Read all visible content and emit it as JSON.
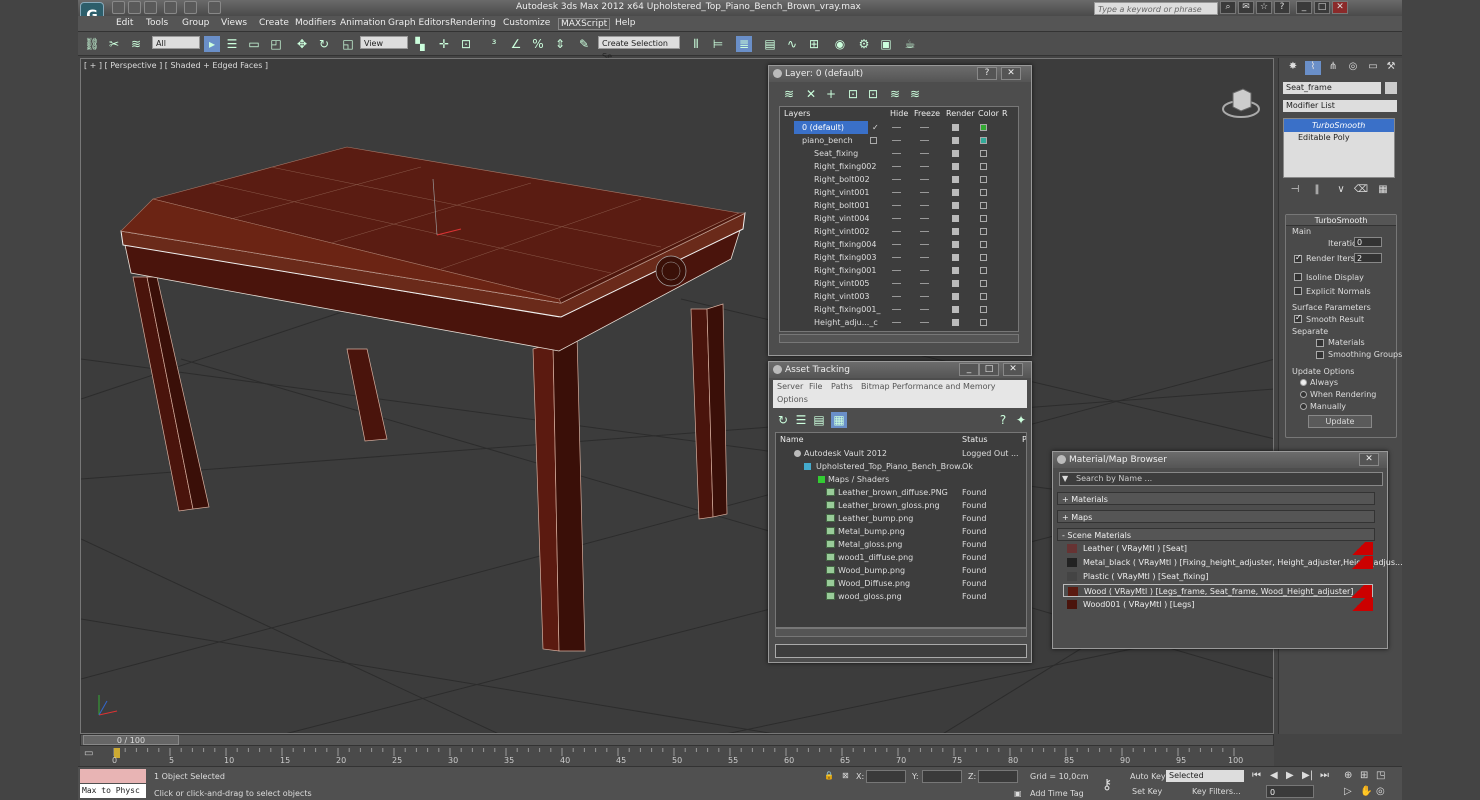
{
  "titlebar": {
    "text": "Autodesk 3ds Max  2012 x64     Upholstered_Top_Piano_Bench_Brown_vray.max",
    "search_placeholder": "Type a keyword or phrase"
  },
  "menu": [
    "Edit",
    "Tools",
    "Group",
    "Views",
    "Create",
    "Modifiers",
    "Animation",
    "Graph Editors",
    "Rendering",
    "Customize",
    "MAXScript",
    "Help"
  ],
  "toolbar": {
    "filter": "All",
    "refcoord": "View",
    "selset": "Create Selection Se"
  },
  "viewport": {
    "label": "[ + ] [ Perspective ] [ Shaded + Edged Faces ]"
  },
  "cmd": {
    "object_name": "Seat_frame",
    "modifier_list": "Modifier List",
    "stack": [
      "TurboSmooth",
      "Editable Poly"
    ],
    "turbosmooth": {
      "title": "TurboSmooth",
      "main": "Main",
      "iterations_label": "Iterations:",
      "iterations": "0",
      "render_iters_label": "Render Iters:",
      "render_iters": "2",
      "isoline": "Isoline Display",
      "explicit": "Explicit Normals",
      "surface": "Surface Parameters",
      "smooth_result": "Smooth Result",
      "separate": "Separate",
      "materials": "Materials",
      "smoothing_groups": "Smoothing Groups",
      "update_options": "Update Options",
      "always": "Always",
      "when_rendering": "When Rendering",
      "manually": "Manually",
      "update": "Update"
    }
  },
  "layer": {
    "title": "Layer: 0 (default)",
    "cols": [
      "Layers",
      "Hide",
      "Freeze",
      "Render",
      "Color",
      "R"
    ],
    "rows": [
      "0 (default)",
      "piano_bench",
      "Seat_fixing",
      "Right_fixing002",
      "Right_bolt002",
      "Right_vint001",
      "Right_bolt001",
      "Right_vint004",
      "Right_vint002",
      "Right_fixing004",
      "Right_fixing003",
      "Right_fixing001",
      "Right_vint005",
      "Right_vint003",
      "Right_fixing001_",
      "Height_adju..._c"
    ]
  },
  "asset": {
    "title": "Asset Tracking",
    "menu": [
      "Server",
      "File",
      "Paths",
      "Bitmap Performance and Memory"
    ],
    "menu2": "Options",
    "cols": [
      "Name",
      "Status",
      "P"
    ],
    "rows": [
      [
        "Autodesk Vault 2012",
        "Logged Out ..."
      ],
      [
        "Upholstered_Top_Piano_Bench_Brow...",
        "Ok"
      ],
      [
        "Maps / Shaders",
        ""
      ],
      [
        "Leather_brown_diffuse.PNG",
        "Found"
      ],
      [
        "Leather_brown_gloss.png",
        "Found"
      ],
      [
        "Leather_bump.png",
        "Found"
      ],
      [
        "Metal_bump.png",
        "Found"
      ],
      [
        "Metal_gloss.png",
        "Found"
      ],
      [
        "wood1_diffuse.png",
        "Found"
      ],
      [
        "Wood_bump.png",
        "Found"
      ],
      [
        "Wood_Diffuse.png",
        "Found"
      ],
      [
        "wood_gloss.png",
        "Found"
      ]
    ]
  },
  "matbrowser": {
    "title": "Material/Map Browser",
    "search": "Search by Name ...",
    "cats": [
      "+ Materials",
      "+ Maps",
      "- Scene Materials"
    ],
    "rows": [
      "Leather  ( VRayMtl ) [Seat]",
      "Metal_black  ( VRayMtl ) [Fixing_height_adjuster, Height_adjuster,Height_adjus...",
      "Plastic  ( VRayMtl ) [Seat_fixing]",
      "Wood  ( VRayMtl ) [Legs_frame, Seat_frame, Wood_Height_adjuster]",
      "Wood001  ( VRayMtl ) [Legs]"
    ]
  },
  "timeline": {
    "frame": "0 / 100",
    "ticks": [
      "0",
      "5",
      "10",
      "15",
      "20",
      "25",
      "30",
      "35",
      "40",
      "45",
      "50",
      "55",
      "60",
      "65",
      "70",
      "75",
      "80",
      "85",
      "90",
      "95",
      "100"
    ]
  },
  "status": {
    "maxscript": "Max to Physc",
    "selected": "1 Object Selected",
    "prompt": "Click or click-and-drag to select objects",
    "x": "X:",
    "y": "Y:",
    "z": "Z:",
    "grid": "Grid = 10,0cm",
    "autokey": "Auto Key",
    "setkey": "Set Key",
    "keyfilter": "Selected",
    "keyfilters": "Key Filters...",
    "addtime": "Add Time Tag",
    "frame": "0"
  },
  "colors": {
    "selection": "#3a70c8",
    "wood": "#5b1a10"
  }
}
